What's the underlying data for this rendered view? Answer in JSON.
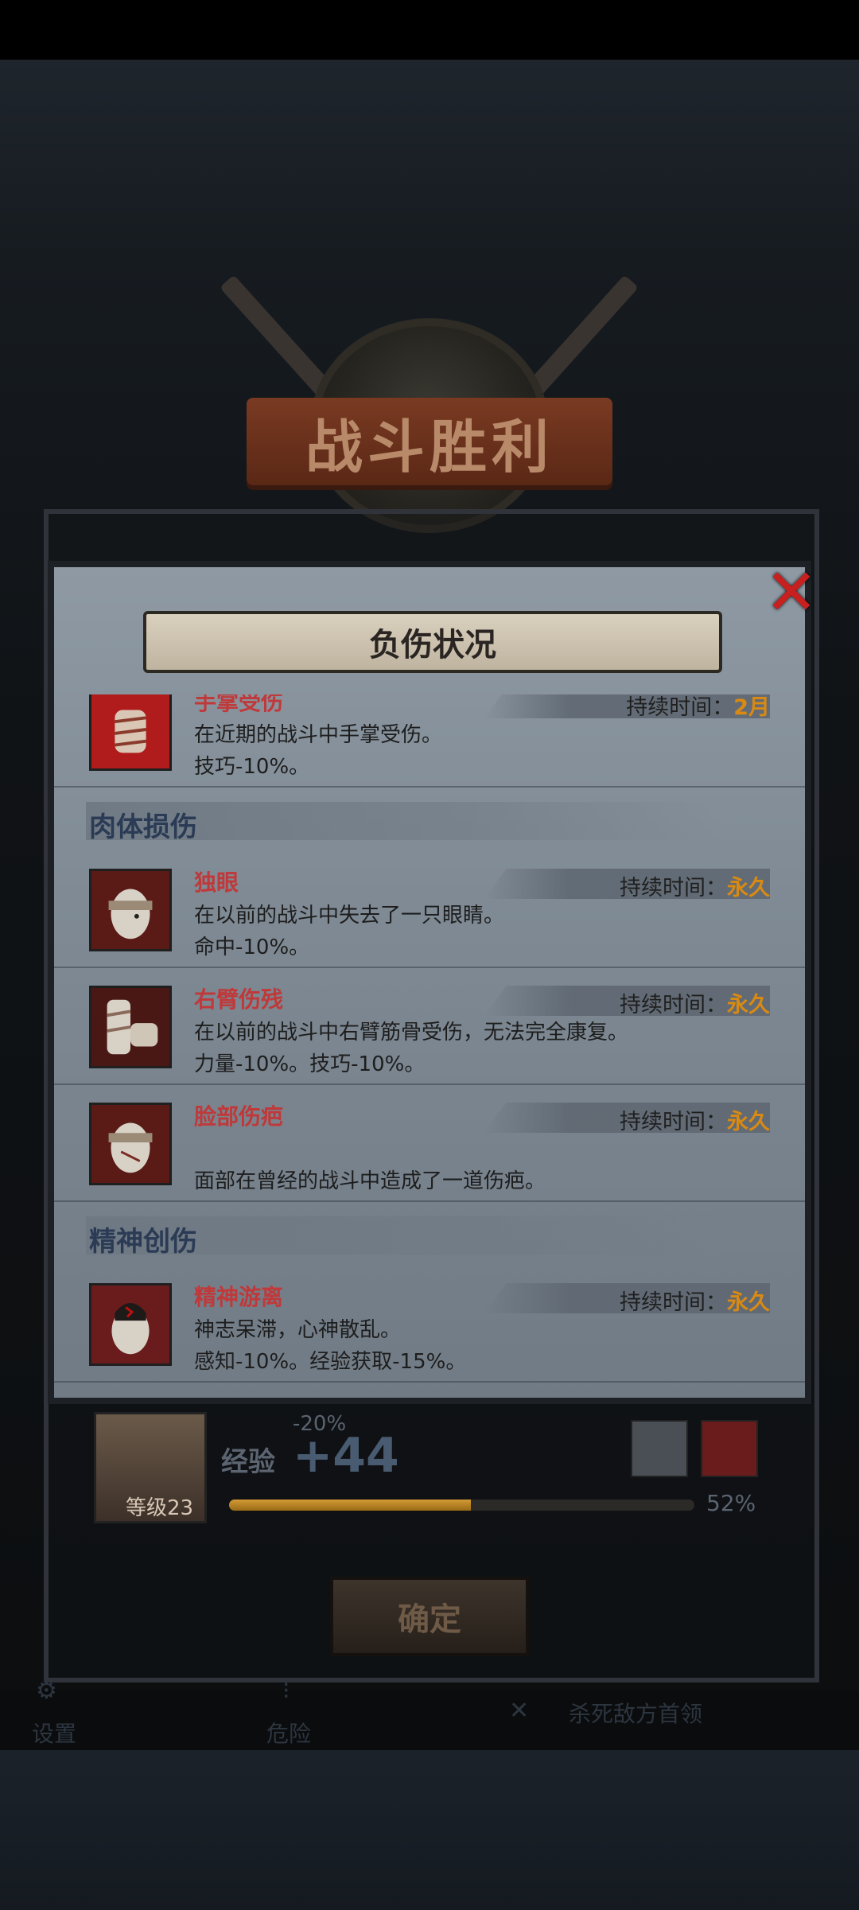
{
  "victory": {
    "title": "战斗胜利"
  },
  "modal": {
    "title": "负伤状况",
    "close_icon": "close-x-icon"
  },
  "duration_label": "持续时间：",
  "top_partial": {
    "name": "手掌受伤",
    "duration": "2月",
    "desc": "在近期的战斗中手掌受伤。",
    "effect": "技巧-10%。",
    "icon": "bandaged-hand-icon"
  },
  "sections": [
    {
      "label": "肉体损伤",
      "items": [
        {
          "name": "独眼",
          "duration": "永久",
          "desc": "在以前的战斗中失去了一只眼睛。",
          "effect": "命中-10%。",
          "icon": "eyepatch-face-icon"
        },
        {
          "name": "右臂伤残",
          "duration": "永久",
          "desc": "在以前的战斗中右臂筋骨受伤，无法完全康复。",
          "effect": "力量-10%。技巧-10%。",
          "icon": "bandaged-arm-icon"
        },
        {
          "name": "脸部伤疤",
          "duration": "永久",
          "desc": "",
          "effect": "面部在曾经的战斗中造成了一道伤疤。",
          "icon": "scarred-face-icon"
        }
      ]
    },
    {
      "label": "精神创伤",
      "items": [
        {
          "name": "精神游离",
          "duration": "永久",
          "desc": "神志呆滞，心神散乱。",
          "effect": "感知-10%。经验获取-15%。",
          "icon": "dazed-head-icon"
        }
      ]
    }
  ],
  "summary": {
    "level": "等级23",
    "exp_label": "经验",
    "exp_penalty": "-20%",
    "exp_gain": "+44",
    "exp_progress": 0.52,
    "exp_percent": "52%"
  },
  "confirm": "确定",
  "nav": {
    "settings": "设置",
    "danger": "危险",
    "objective": "杀死敌方首领"
  },
  "colors": {
    "injury_name": "#c0393a",
    "duration_value": "#d98a12",
    "section_label": "#2b3b55",
    "close": "#c81f1f"
  }
}
